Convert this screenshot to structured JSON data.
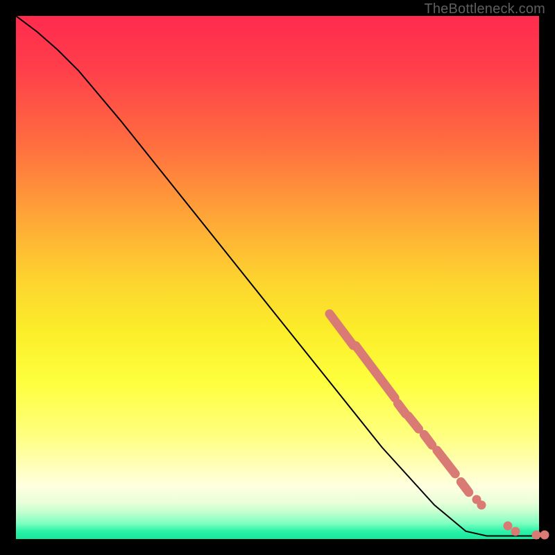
{
  "watermark": "TheBottleneck.com",
  "chart_data": {
    "type": "line",
    "title": "",
    "xlabel": "",
    "ylabel": "",
    "xlim": [
      0,
      100
    ],
    "ylim": [
      0,
      100
    ],
    "grid": false,
    "curve": [
      {
        "x": 0,
        "y": 100
      },
      {
        "x": 4,
        "y": 97
      },
      {
        "x": 8,
        "y": 93.5
      },
      {
        "x": 12,
        "y": 89.5
      },
      {
        "x": 20,
        "y": 80
      },
      {
        "x": 30,
        "y": 67.5
      },
      {
        "x": 40,
        "y": 55
      },
      {
        "x": 50,
        "y": 42.5
      },
      {
        "x": 60,
        "y": 30
      },
      {
        "x": 70,
        "y": 17.5
      },
      {
        "x": 80,
        "y": 6.5
      },
      {
        "x": 86,
        "y": 1.5
      },
      {
        "x": 90,
        "y": 0.6
      },
      {
        "x": 95,
        "y": 0.6
      },
      {
        "x": 100,
        "y": 0.6
      }
    ],
    "marker_segments": [
      {
        "x0": 60,
        "y0": 43,
        "x1": 64.5,
        "y1": 37
      },
      {
        "x0": 65,
        "y0": 37,
        "x1": 72.5,
        "y1": 27
      },
      {
        "x0": 73,
        "y0": 26,
        "x1": 74.5,
        "y1": 24
      },
      {
        "x0": 75,
        "y0": 23.5,
        "x1": 77,
        "y1": 21
      },
      {
        "x0": 78,
        "y0": 20,
        "x1": 79.5,
        "y1": 18
      },
      {
        "x0": 80.5,
        "y0": 17,
        "x1": 84,
        "y1": 12.5
      },
      {
        "x0": 85,
        "y0": 11,
        "x1": 86.5,
        "y1": 9
      }
    ],
    "marker_points": [
      {
        "x": 88,
        "y": 7.5
      },
      {
        "x": 89,
        "y": 6.5
      },
      {
        "x": 94,
        "y": 2.5
      },
      {
        "x": 95.5,
        "y": 1.5
      },
      {
        "x": 99.5,
        "y": 0.8
      },
      {
        "x": 101,
        "y": 0.8
      }
    ]
  }
}
